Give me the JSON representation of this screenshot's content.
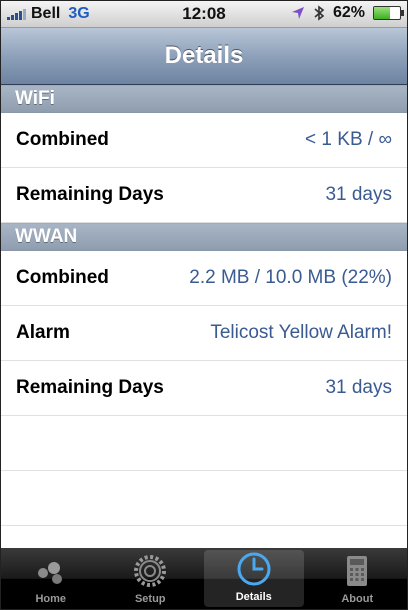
{
  "status_bar": {
    "carrier": "Bell",
    "network": "3G",
    "time": "12:08",
    "battery_percent": "62%",
    "battery_level": 0.62,
    "icons": [
      "signal-icon",
      "location-icon",
      "bluetooth-icon",
      "battery-icon"
    ]
  },
  "nav": {
    "title": "Details"
  },
  "sections": [
    {
      "header": "WiFi",
      "rows": [
        {
          "label": "Combined",
          "value": "< 1 KB / ∞"
        },
        {
          "label": "Remaining Days",
          "value": "31 days"
        }
      ]
    },
    {
      "header": "WWAN",
      "rows": [
        {
          "label": "Combined",
          "value": "2.2 MB / 10.0 MB (22%)"
        },
        {
          "label": "Alarm",
          "value": "Telicost Yellow Alarm!"
        },
        {
          "label": "Remaining Days",
          "value": "31 days"
        }
      ]
    }
  ],
  "tab_bar": {
    "tabs": [
      {
        "label": "Home",
        "icon": "home-dots-icon",
        "active": false
      },
      {
        "label": "Setup",
        "icon": "gear-icon",
        "active": false
      },
      {
        "label": "Details",
        "icon": "clock-icon",
        "active": true
      },
      {
        "label": "About",
        "icon": "calculator-icon",
        "active": false
      }
    ]
  },
  "colors": {
    "value_text": "#3a5a92",
    "nav_bar": "#8ea1ba",
    "section_header": "#9aa7b8",
    "active_icon": "#4aa8f0"
  }
}
